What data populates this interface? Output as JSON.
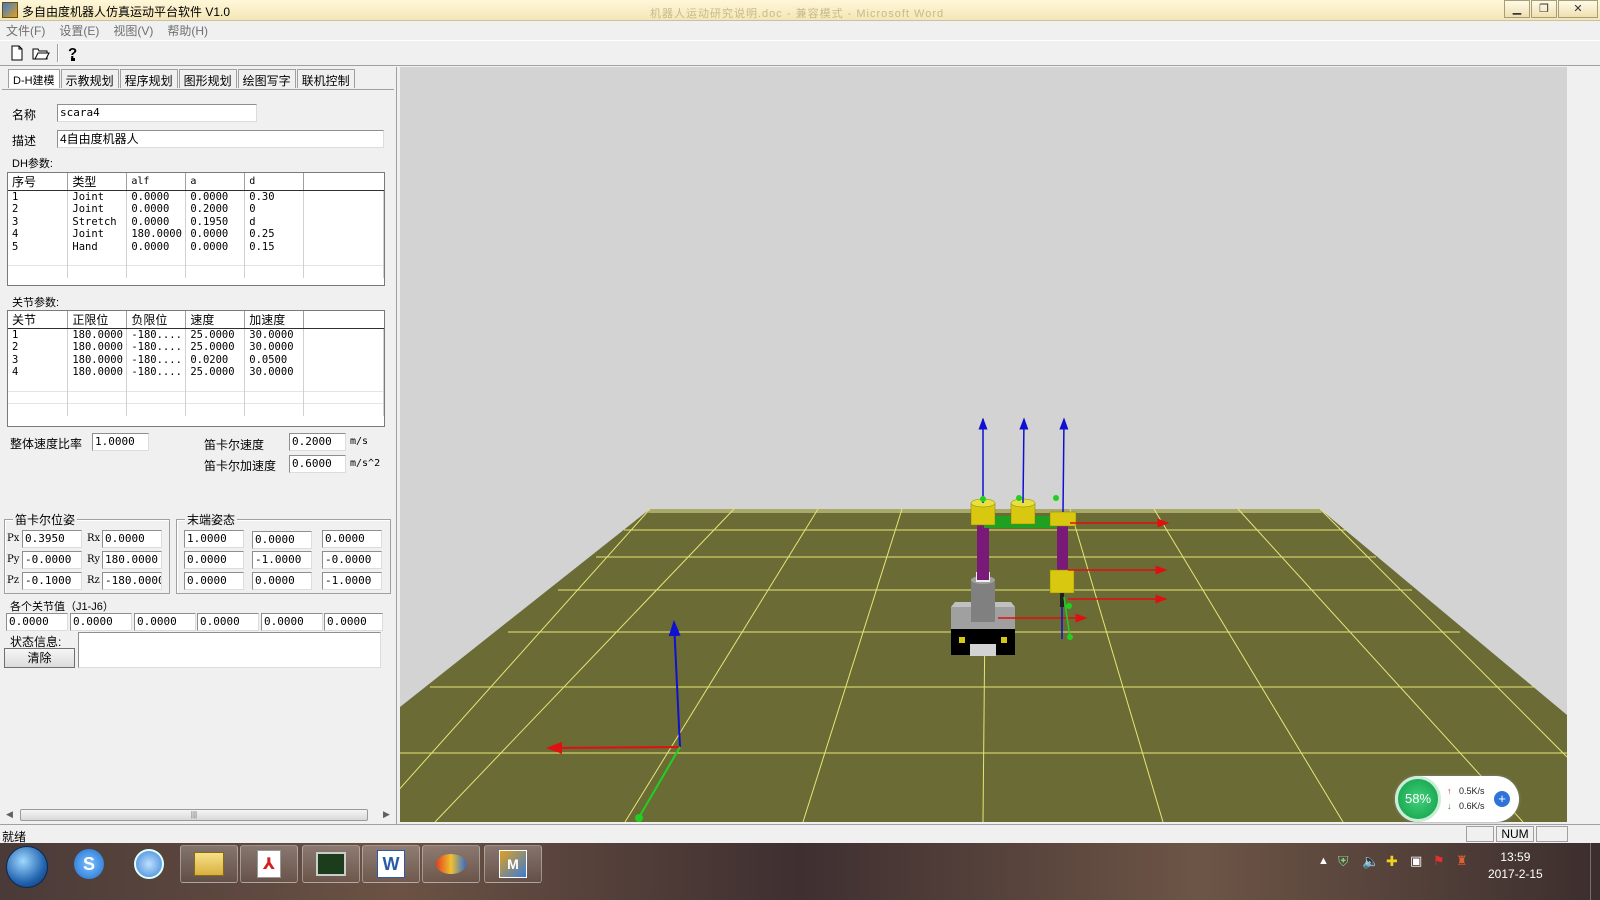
{
  "window": {
    "title": "多自由度机器人仿真运动平台软件 V1.0",
    "background_text": "机器人运动研究说明.doc - 兼容模式 - Microsoft Word",
    "controls": [
      "▁",
      "❐",
      "✕"
    ]
  },
  "menu": [
    "文件(F)",
    "设置(E)",
    "视图(V)",
    "帮助(H)"
  ],
  "tabs": [
    "D-H建模",
    "示教规划",
    "程序规划",
    "图形规划",
    "绘图写字",
    "联机控制"
  ],
  "form": {
    "name_label": "名称",
    "name_value": "scara4",
    "desc_label": "描述",
    "desc_value": "4自由度机器人",
    "dh_label": "DH参数:",
    "joint_label": "关节参数:"
  },
  "dh_table": {
    "headers": [
      "序号",
      "类型",
      "alf",
      "a",
      "d"
    ],
    "rows": [
      [
        "1",
        "Joint",
        "0.0000",
        "0.0000",
        "0.30"
      ],
      [
        "2",
        "Joint",
        "0.0000",
        "0.2000",
        "0"
      ],
      [
        "3",
        "Stretch",
        "0.0000",
        "0.1950",
        "d"
      ],
      [
        "4",
        "Joint",
        "180.0000",
        "0.0000",
        "0.25"
      ],
      [
        "5",
        "Hand",
        "0.0000",
        "0.0000",
        "0.15"
      ]
    ]
  },
  "joint_table": {
    "headers": [
      "关节",
      "正限位",
      "负限位",
      "速度",
      "加速度"
    ],
    "rows": [
      [
        "1",
        "180.0000",
        "-180....",
        "25.0000",
        "30.0000"
      ],
      [
        "2",
        "180.0000",
        "-180....",
        "25.0000",
        "30.0000"
      ],
      [
        "3",
        "180.0000",
        "-180....",
        "0.0200",
        "0.0500"
      ],
      [
        "4",
        "180.0000",
        "-180....",
        "25.0000",
        "30.0000"
      ]
    ]
  },
  "speed": {
    "ratio_label": "整体速度比率",
    "ratio_value": "1.0000",
    "cart_speed_label": "笛卡尔速度",
    "cart_speed_value": "0.2000",
    "cart_speed_unit": "m/s",
    "cart_acc_label": "笛卡尔加速度",
    "cart_acc_value": "0.6000",
    "cart_acc_unit": "m/s^2"
  },
  "cart_pose": {
    "title": "笛卡尔位姿",
    "labels": [
      "Px",
      "Rx",
      "Py",
      "Ry",
      "Pz",
      "Rz"
    ],
    "values": [
      "0.3950",
      "0.0000",
      "-0.0000",
      "180.0000",
      "-0.1000",
      "-180.0000"
    ]
  },
  "end_pose": {
    "title": "末端姿态",
    "values": [
      "1.0000",
      "0.0000",
      "0.0000",
      "0.0000",
      "-1.0000",
      "-0.0000",
      "0.0000",
      "0.0000",
      "-1.0000"
    ]
  },
  "joints": {
    "title": "各个关节值（J1-J6）",
    "values": [
      "0.0000",
      "0.0000",
      "0.0000",
      "0.0000",
      "0.0000",
      "0.0000"
    ]
  },
  "status": {
    "label": "状态信息:",
    "clear_button": "清除",
    "message": ""
  },
  "statusbar": {
    "text": "就绪",
    "num": "NUM"
  },
  "network_widget": {
    "percent": "58%",
    "up": "0.5K/s",
    "down": "0.6K/s"
  },
  "clock": {
    "time": "13:59",
    "date": "2017-2-15"
  },
  "colors": {
    "floor": "#6b6b35",
    "grid_line": "#e6e675",
    "link_purple": "#7a1a78",
    "joint_yellow": "#d8c810",
    "arm_green": "#20a020",
    "axis_x": "#e01010",
    "axis_y": "#20d020",
    "axis_z": "#1010d0",
    "base": "#808080"
  }
}
